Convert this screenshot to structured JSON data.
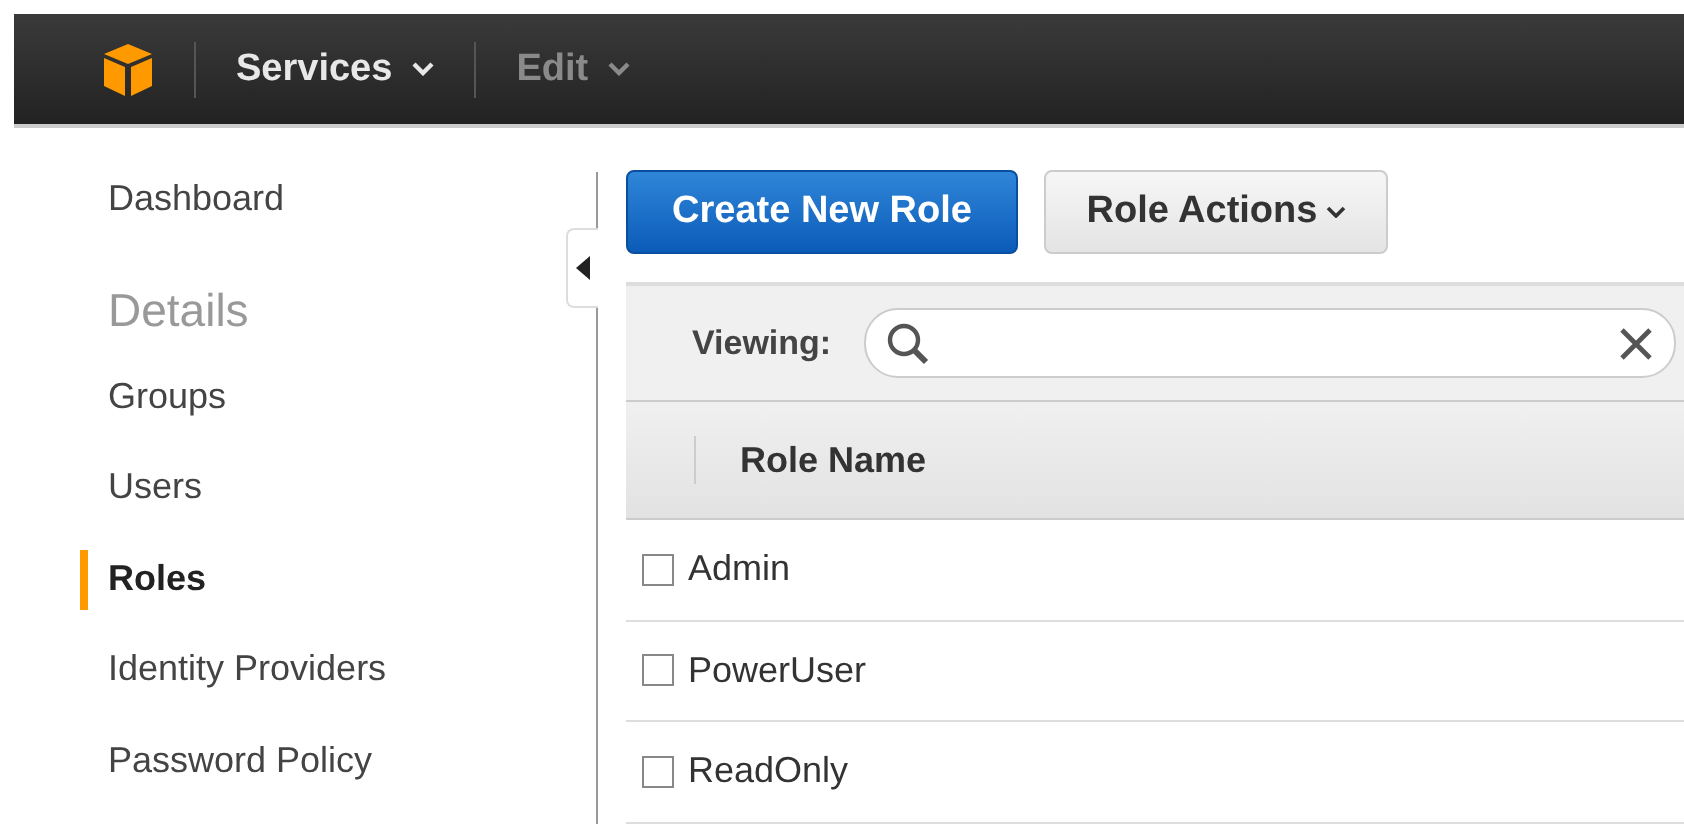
{
  "top_bar": {
    "menus": [
      {
        "label": "Services",
        "disabled": false
      },
      {
        "label": "Edit",
        "disabled": true
      }
    ]
  },
  "sidebar": {
    "items": [
      {
        "kind": "link",
        "label": "Dashboard",
        "selected": false
      },
      {
        "kind": "heading",
        "label": "Details"
      },
      {
        "kind": "link",
        "label": "Groups",
        "selected": false
      },
      {
        "kind": "link",
        "label": "Users",
        "selected": false
      },
      {
        "kind": "link",
        "label": "Roles",
        "selected": true
      },
      {
        "kind": "link",
        "label": "Identity Providers",
        "selected": false
      },
      {
        "kind": "link",
        "label": "Password Policy",
        "selected": false
      }
    ]
  },
  "toolbar": {
    "primary_button": "Create New Role",
    "actions_button": "Role Actions"
  },
  "filter": {
    "label": "Viewing:"
  },
  "table": {
    "columns": [
      "Role Name"
    ],
    "rows": [
      {
        "name": "Admin",
        "checked": false
      },
      {
        "name": "PowerUser",
        "checked": false
      },
      {
        "name": "ReadOnly",
        "checked": false
      }
    ]
  }
}
